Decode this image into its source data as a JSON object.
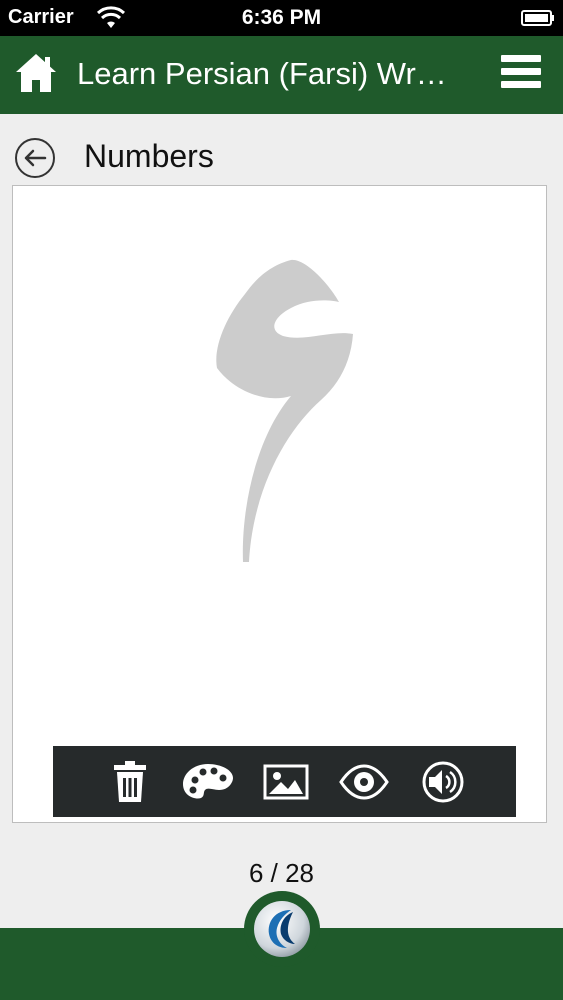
{
  "status_bar": {
    "carrier": "Carrier",
    "time": "6:36 PM",
    "icons": [
      "wifi-icon",
      "battery-icon"
    ]
  },
  "header": {
    "title": "Learn Persian (Farsi) Wr…",
    "icons": [
      "home-icon",
      "menu-icon"
    ],
    "color": "#1f5a2b"
  },
  "page": {
    "section_title": "Numbers",
    "back_icon": "back-arrow-icon",
    "glyph": "۶",
    "counter": "6 / 28"
  },
  "toolbar": {
    "tools": [
      "trash-icon",
      "palette-icon",
      "image-icon",
      "eye-icon",
      "speaker-icon"
    ],
    "color": "#262a2b"
  },
  "footer": {
    "logo": "app-logo-icon",
    "color": "#1f5a2b"
  }
}
